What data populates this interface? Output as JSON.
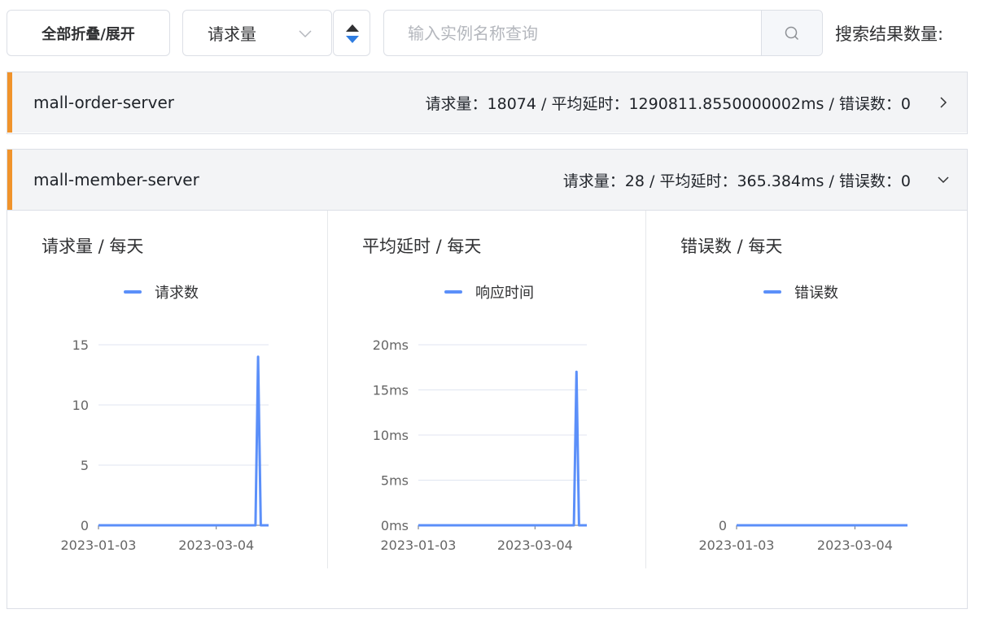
{
  "toolbar": {
    "collapse_label": "全部折叠/展开",
    "metric_select_value": "请求量",
    "search_placeholder": "输入实例名称查询",
    "search_value": "",
    "result_count_label": "搜索结果数量:"
  },
  "colors": {
    "accent_border": "#f0932b",
    "series_line": "#5b8ff9",
    "sort_active": "#2f7de1"
  },
  "icons": [
    "sort-ascending-icon",
    "sort-descending-icon",
    "search-icon",
    "chevron-down-icon",
    "chevron-right-icon"
  ],
  "instances": [
    {
      "name": "mall-order-server",
      "stats": "请求量：18074 / 平均延时：1290811.8550000002ms / 错误数：0",
      "expanded": false
    },
    {
      "name": "mall-member-server",
      "stats": "请求量：28 / 平均延时：365.384ms / 错误数：0",
      "expanded": true
    }
  ],
  "chart_data": [
    {
      "type": "line",
      "title": "请求量 / 每天",
      "legend": "请求数",
      "series": [
        {
          "name": "请求数",
          "values": [
            [
              0,
              0
            ],
            [
              60,
              0
            ],
            [
              61,
              14
            ],
            [
              62,
              0
            ],
            [
              65,
              0
            ]
          ]
        }
      ],
      "x_ticks": [
        "2023-01-03",
        "2023-03-04"
      ],
      "y_ticks": [
        "0",
        "5",
        "10",
        "15"
      ],
      "ylim": [
        0,
        15
      ],
      "xlim": [
        0,
        65
      ],
      "x_tick_positions": [
        0,
        45
      ]
    },
    {
      "type": "line",
      "title": "平均延时 / 每天",
      "legend": "响应时间",
      "series": [
        {
          "name": "响应时间",
          "values": [
            [
              0,
              0
            ],
            [
              60,
              0
            ],
            [
              61,
              17
            ],
            [
              62,
              0
            ],
            [
              65,
              0
            ]
          ]
        }
      ],
      "x_ticks": [
        "2023-01-03",
        "2023-03-04"
      ],
      "y_ticks": [
        "0ms",
        "5ms",
        "10ms",
        "15ms",
        "20ms"
      ],
      "ylim": [
        0,
        20
      ],
      "xlim": [
        0,
        65
      ],
      "x_tick_positions": [
        0,
        45
      ]
    },
    {
      "type": "line",
      "title": "错误数 / 每天",
      "legend": "错误数",
      "series": [
        {
          "name": "错误数",
          "values": [
            [
              0,
              0
            ],
            [
              65,
              0
            ]
          ]
        }
      ],
      "x_ticks": [
        "2023-01-03",
        "2023-03-04"
      ],
      "y_ticks": [
        "0"
      ],
      "ylim": [
        0,
        1
      ],
      "xlim": [
        0,
        65
      ],
      "x_tick_positions": [
        0,
        45
      ]
    }
  ]
}
